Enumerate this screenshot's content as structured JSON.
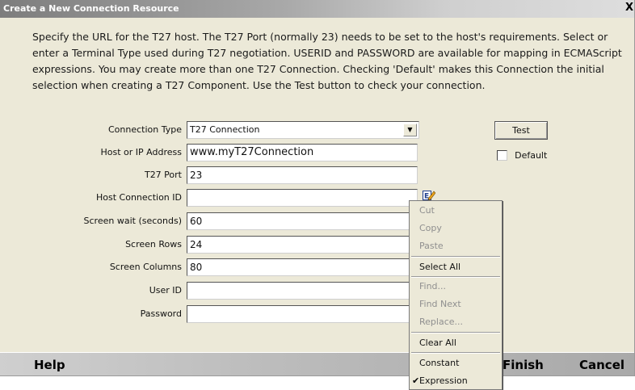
{
  "dialog": {
    "title": "Create a New Connection Resource",
    "close_glyph": "X",
    "intro": "Specify the URL for the T27 host.  The T27 Port (normally 23) needs to be set to the host's requirements. Select or enter a Terminal Type used during T27 negotiation.  USERID and PASSWORD are available for mapping in ECMAScript expressions.  You may create more than one T27 Connection.  Checking 'Default' makes this Connection the initial selection when creating a T27 Component.  Use the Test button to check your connection."
  },
  "form": {
    "connection_type": {
      "label": "Connection Type",
      "value": "T27 Connection"
    },
    "host": {
      "label": "Host or IP Address",
      "value": "www.myT27Connection"
    },
    "port": {
      "label": "T27 Port",
      "value": "23"
    },
    "host_conn_id": {
      "label": "Host Connection ID",
      "value": ""
    },
    "screen_wait": {
      "label": "Screen wait (seconds)",
      "value": "60"
    },
    "screen_rows": {
      "label": "Screen Rows",
      "value": "24"
    },
    "screen_cols": {
      "label": "Screen Columns",
      "value": "80"
    },
    "user_id": {
      "label": "User ID",
      "value": ""
    },
    "password": {
      "label": "Password",
      "value": ""
    }
  },
  "buttons": {
    "test": "Test",
    "default_checkbox": "Default"
  },
  "footer": {
    "help": "Help",
    "finish": "Finish",
    "cancel": "Cancel"
  },
  "context_menu": {
    "cut": "Cut",
    "copy": "Copy",
    "paste": "Paste",
    "select_all": "Select All",
    "find": "Find...",
    "find_next": "Find Next",
    "replace": "Replace...",
    "clear_all": "Clear All",
    "constant": "Constant",
    "expression": "Expression",
    "check_glyph": "✔"
  },
  "icons": {
    "edit": "edit-expression-icon",
    "dropdown": "chevron-down-icon"
  },
  "colors": {
    "panel": "#ece9d8",
    "title_start": "#7d7d7d",
    "title_end": "#dedede"
  }
}
